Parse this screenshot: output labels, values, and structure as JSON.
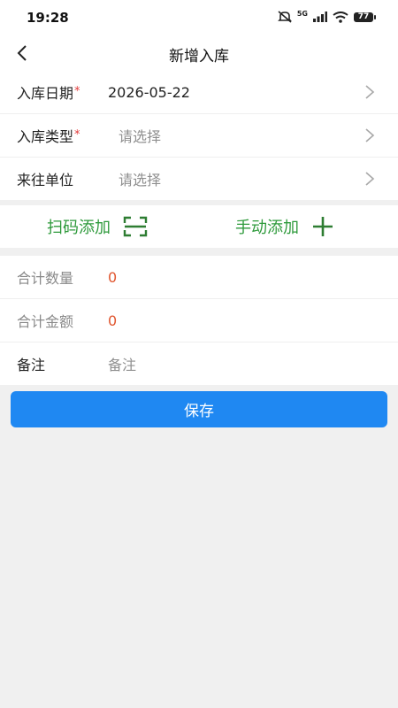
{
  "status_bar": {
    "time": "19:28",
    "network": "5G",
    "battery": "77"
  },
  "nav": {
    "title": "新增入库"
  },
  "form": {
    "date": {
      "label": "入库日期",
      "required_mark": "*",
      "value": "2026-05-22"
    },
    "type": {
      "label": "入库类型",
      "required_mark": "*",
      "placeholder": "请选择"
    },
    "partner": {
      "label": "来往单位",
      "placeholder": "请选择"
    }
  },
  "add_actions": {
    "scan_label": "扫码添加",
    "manual_label": "手动添加"
  },
  "summary": {
    "total_qty": {
      "label": "合计数量",
      "value": "0"
    },
    "total_amount": {
      "label": "合计金额",
      "value": "0"
    },
    "remark": {
      "label": "备注",
      "placeholder": "备注"
    }
  },
  "save_button": {
    "label": "保存"
  },
  "colors": {
    "primary": "#1f88f2",
    "green": "#2e9a3b",
    "required": "#e23b3b",
    "zero_value": "#e0552e",
    "background": "#f0f0f0"
  }
}
